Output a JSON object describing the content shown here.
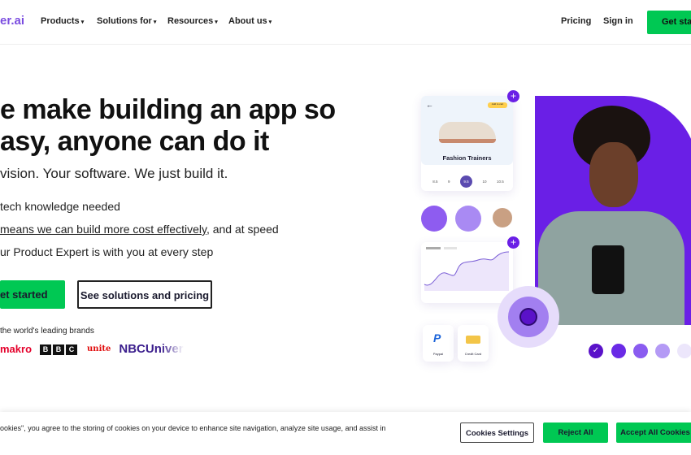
{
  "nav": {
    "logo": "er.ai",
    "items": [
      {
        "label": "Products"
      },
      {
        "label": "Solutions for"
      },
      {
        "label": "Resources"
      },
      {
        "label": "About us"
      }
    ],
    "caret": "▾",
    "pricing": "Pricing",
    "signin": "Sign in",
    "get_started": "Get start"
  },
  "hero": {
    "headline_1": "e make building an app so",
    "headline_2": "asy, anyone can do it",
    "subtitle": "vision. Your software. We just build it.",
    "bullets": [
      {
        "pre": "tech knowledge needed",
        "link": "",
        "post": ""
      },
      {
        "pre": "",
        "link": "means we can build more cost effectively",
        "post": ", and at speed"
      },
      {
        "pre": "ur Product Expert is with you at every step",
        "link": "",
        "post": ""
      }
    ],
    "cta_primary": "et started",
    "cta_secondary": "See solutions and pricing",
    "brands_label": "the world's leading brands",
    "brands": [
      "makro",
      "BBC",
      "unite",
      "NBCUniver"
    ]
  },
  "illustration": {
    "product_title": "Fashion Trainers",
    "badge": "Add to cart",
    "sizes": [
      "8.5",
      "9",
      "9.5",
      "10",
      "10.5"
    ],
    "selected_size": "9.5",
    "paypal": "Paypal",
    "credit_card": "Credit Card",
    "accent": "#6a1fe6"
  },
  "cookie": {
    "text": "ookies\", you agree to the storing of cookies on your device to enhance site navigation, analyze site usage, and assist in",
    "settings": "Cookies Settings",
    "reject": "Reject All",
    "accept": "Accept All Cookies"
  },
  "colors": {
    "green": "#00c853",
    "purple": "#6a1fe6"
  }
}
